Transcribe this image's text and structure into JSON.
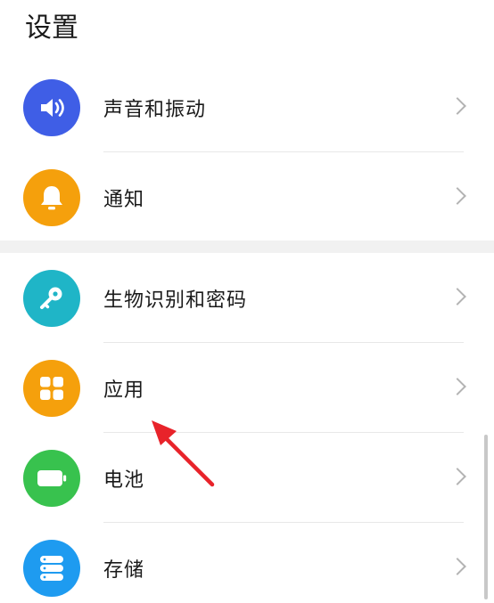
{
  "header": {
    "title": "设置"
  },
  "settings": {
    "group1": [
      {
        "label": "声音和振动",
        "icon": "speaker-icon",
        "color": "#3F5EE6"
      },
      {
        "label": "通知",
        "icon": "bell-icon",
        "color": "#F5A00C"
      }
    ],
    "group2": [
      {
        "label": "生物识别和密码",
        "icon": "key-icon",
        "color": "#1FB5C7"
      },
      {
        "label": "应用",
        "icon": "apps-grid-icon",
        "color": "#F5A00C"
      },
      {
        "label": "电池",
        "icon": "battery-icon",
        "color": "#38C24E"
      },
      {
        "label": "存储",
        "icon": "storage-icon",
        "color": "#1E9BF0"
      }
    ]
  },
  "annotation": {
    "arrow_color": "#E8232A"
  }
}
